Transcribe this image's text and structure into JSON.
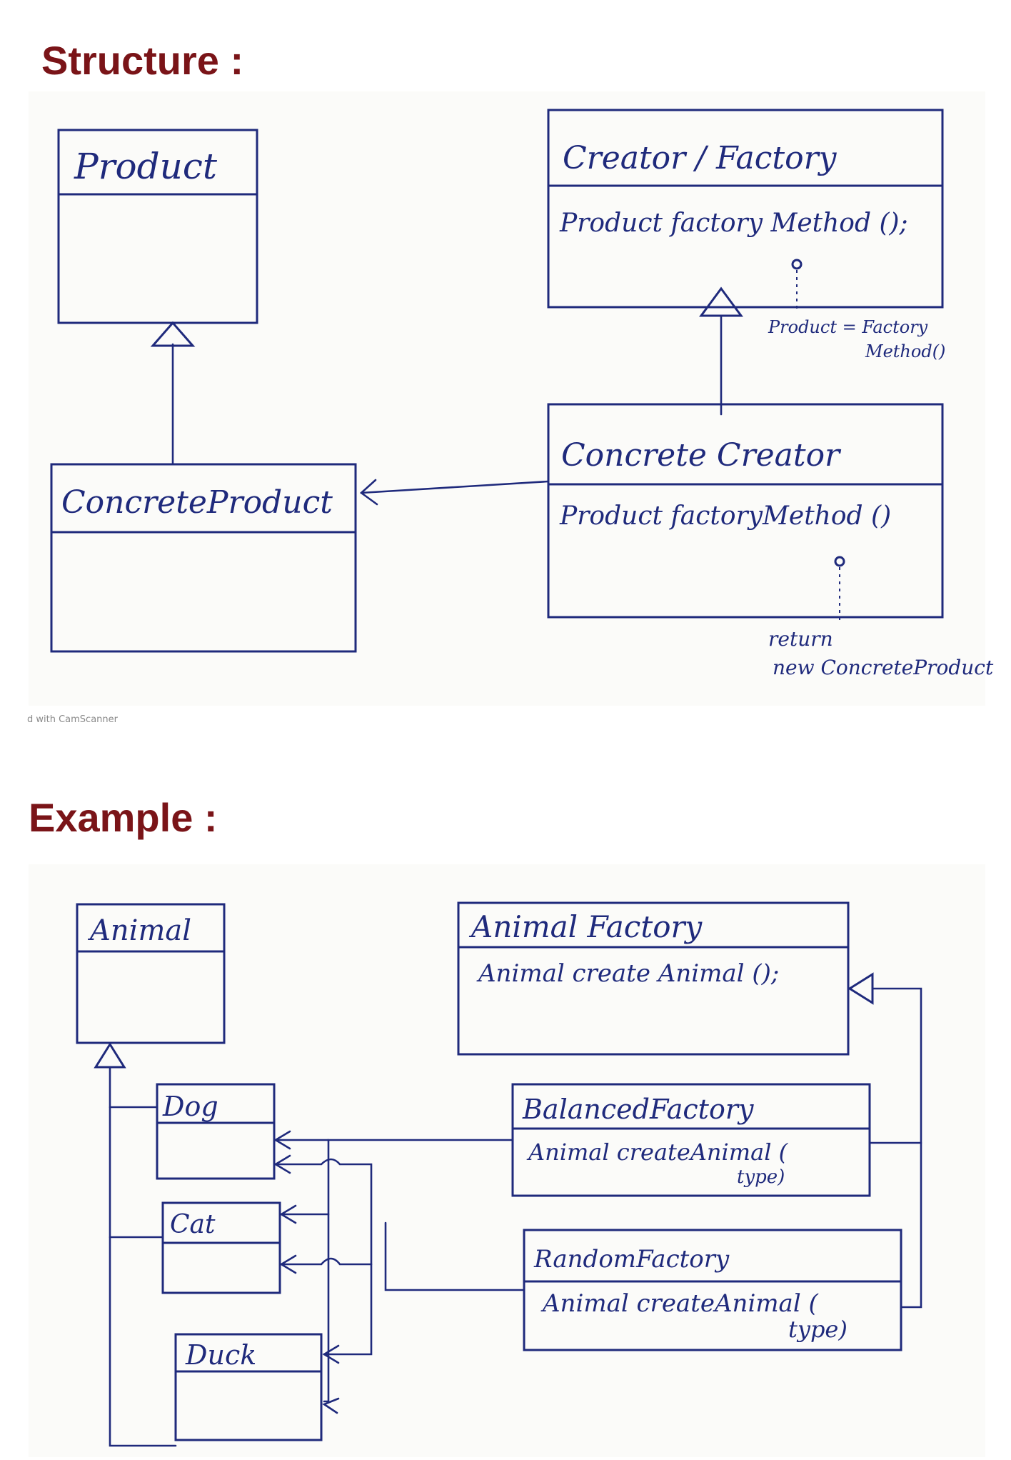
{
  "headings": {
    "structure": "Structure :",
    "example": "Example :"
  },
  "watermark": "d with CamScanner",
  "structure": {
    "product": {
      "name": "Product"
    },
    "concrete_product": {
      "name": "ConcreteProduct"
    },
    "creator": {
      "name": "Creator / Factory",
      "method": "Product factory Method ();"
    },
    "concrete_creator": {
      "name": "Concrete Creator",
      "method": "Product factoryMethod ()"
    },
    "note_creator": {
      "line1": "Product = Factory",
      "line2": "Method()"
    },
    "note_concrete": {
      "line1": "return",
      "line2": "new ConcreteProduct"
    }
  },
  "example": {
    "animal": {
      "name": "Animal"
    },
    "dog": {
      "name": "Dog"
    },
    "cat": {
      "name": "Cat"
    },
    "duck": {
      "name": "Duck"
    },
    "animal_factory": {
      "name": "Animal Factory",
      "method": "Animal create Animal ();"
    },
    "balanced_factory": {
      "name": "BalancedFactory",
      "method": "Animal createAnimal (",
      "method_cont": "type)"
    },
    "random_factory": {
      "name": "RandomFactory",
      "method": "Animal createAnimal (",
      "method_cont": "type)"
    }
  },
  "colors": {
    "heading": "#7a1418",
    "ink": "#1f2a7c",
    "paper": "#fbfbf9"
  }
}
